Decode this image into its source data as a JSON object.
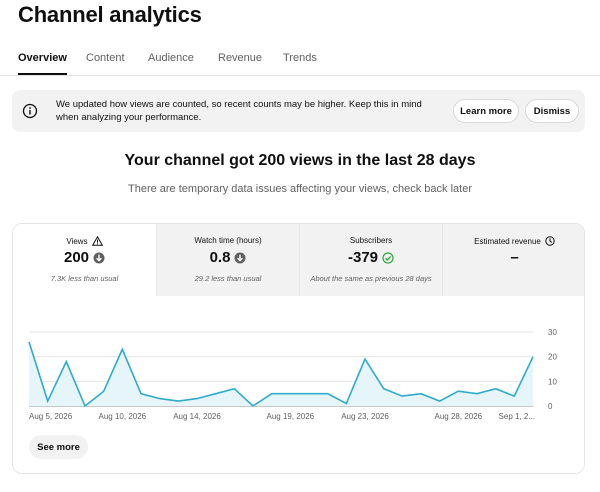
{
  "page": {
    "title": "Channel analytics"
  },
  "tabs": [
    {
      "label": "Overview",
      "active": true
    },
    {
      "label": "Content"
    },
    {
      "label": "Audience"
    },
    {
      "label": "Revenue"
    },
    {
      "label": "Trends"
    }
  ],
  "notice": {
    "text": "We updated how views are counted, so recent counts may be higher. Keep this in mind when analyzing your performance.",
    "learn_more": "Learn more",
    "dismiss": "Dismiss",
    "icon": "info-icon"
  },
  "summary": {
    "headline": "Your channel got 200 views in the last 28 days",
    "subline": "There are temporary data issues affecting your views, check back later"
  },
  "metrics": [
    {
      "label": "Views",
      "value": "200",
      "note": "7.3K less than usual",
      "label_icon": "warning-icon",
      "value_icon": "down-arrow-icon"
    },
    {
      "label": "Watch time (hours)",
      "value": "0.8",
      "note": "29.2 less than usual",
      "value_icon": "down-arrow-icon"
    },
    {
      "label": "Subscribers",
      "value": "-379",
      "note": "About the same as previous 28 days",
      "value_icon": "check-circle-icon"
    },
    {
      "label": "Estimated revenue",
      "value": "–",
      "note": "",
      "label_icon": "clock-icon"
    }
  ],
  "colors": {
    "accent": "#2eabc9",
    "fill": "#e6f5fa",
    "gray": "#606060",
    "green": "#2ba640"
  },
  "chart_data": {
    "type": "area",
    "series": [
      {
        "values": [
          26,
          2,
          18,
          0,
          6,
          23,
          5,
          3,
          2,
          3,
          5,
          7,
          0,
          5,
          5,
          5,
          5,
          1,
          19,
          7,
          4,
          5,
          2,
          6,
          5,
          7,
          4,
          20
        ]
      }
    ],
    "x_tick_labels": [
      "Aug 5, 2026",
      "Aug 10, 2026",
      "Aug 14, 2026",
      "Aug 19, 2026",
      "Aug 23, 2026",
      "Aug 28, 2026",
      "Sep 1, 2..."
    ],
    "x_tick_index": [
      0,
      5,
      9,
      14,
      18,
      23,
      27
    ],
    "y_ticks": [
      0,
      10,
      20,
      30
    ],
    "ylim": [
      0,
      30
    ],
    "grid": true
  },
  "footer": {
    "see_more": "See more"
  }
}
